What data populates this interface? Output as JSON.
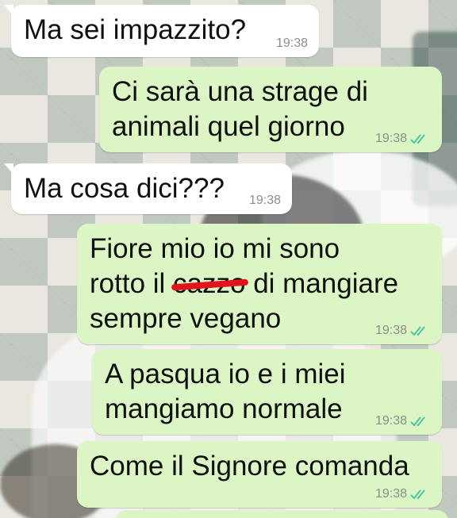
{
  "messages": [
    {
      "id": "m1",
      "direction": "incoming",
      "text": "Ma sei impazzito?",
      "time": "19:38"
    },
    {
      "id": "m2",
      "direction": "outgoing",
      "lines": [
        "Ci sarà una strage di",
        "animali quel giorno"
      ],
      "time": "19:38",
      "status": "read"
    },
    {
      "id": "m3",
      "direction": "incoming",
      "text": "Ma cosa dici???",
      "time": "19:38"
    },
    {
      "id": "m4",
      "direction": "outgoing",
      "line1": "Fiore mio io mi sono",
      "line2_before": "rotto il ",
      "line2_struck": "cazzo",
      "line2_after": " di mangiare",
      "line3": "sempre vegano",
      "time": "19:38",
      "status": "read"
    },
    {
      "id": "m5",
      "direction": "outgoing",
      "lines": [
        "A pasqua io e i miei",
        "mangiamo normale"
      ],
      "time": "19:38",
      "status": "read"
    },
    {
      "id": "m6",
      "direction": "outgoing",
      "text": "Come il Signore comanda",
      "time": "19:38",
      "status": "read"
    }
  ],
  "colors": {
    "incoming_bubble": "#ffffff",
    "outgoing_bubble": "#dcf5c4",
    "read_ticks": "#4fc3a1",
    "strike": "#e0141b"
  },
  "icons": {
    "read_receipt": "double-check-icon"
  }
}
